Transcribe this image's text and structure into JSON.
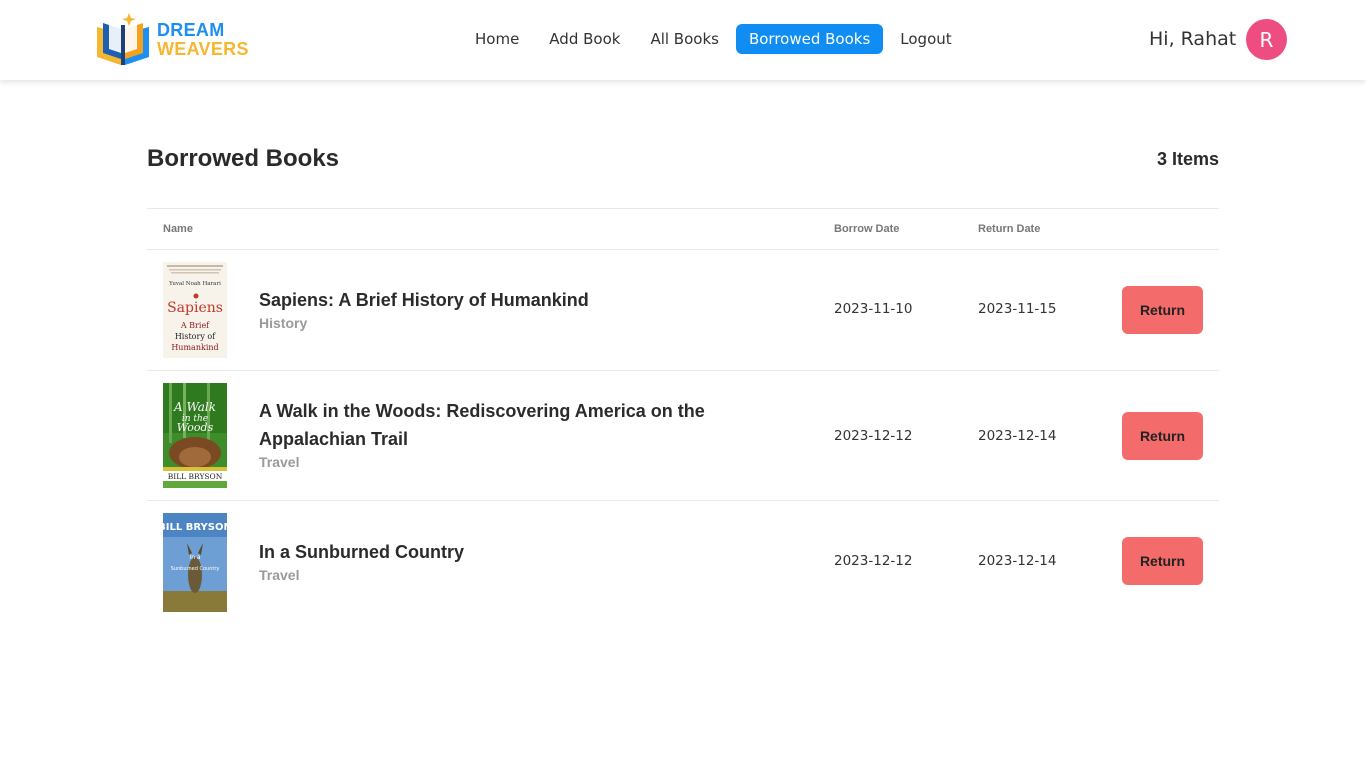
{
  "brand": {
    "line1": "DREAM",
    "line2": "WEAVERS"
  },
  "nav": {
    "items": [
      {
        "label": "Home"
      },
      {
        "label": "Add Book"
      },
      {
        "label": "All Books"
      },
      {
        "label": "Borrowed Books",
        "active": true
      },
      {
        "label": "Logout"
      }
    ]
  },
  "user": {
    "greeting": "Hi, Rahat",
    "avatar_letter": "R"
  },
  "main": {
    "title": "Borrowed Books",
    "count": "3 Items",
    "columns": {
      "name": "Name",
      "borrow": "Borrow Date",
      "return": "Return Date"
    },
    "rows": [
      {
        "title": "Sapiens: A Brief History of Humankind",
        "category": "History",
        "borrow_date": "2023-11-10",
        "return_date": "2023-11-15",
        "action": "Return",
        "cover": {
          "author": "Yuval Noah Harari",
          "word": "Sapiens",
          "sub1": "A Brief",
          "sub2": "History of",
          "sub3": "Humankind"
        }
      },
      {
        "title": "A Walk in the Woods: Rediscovering America on the Appalachian Trail",
        "category": "Travel",
        "borrow_date": "2023-12-12",
        "return_date": "2023-12-14",
        "action": "Return",
        "cover": {
          "t1": "A Walk",
          "t2": "in the",
          "t3": "Woods",
          "author": "BILL BRYSON"
        }
      },
      {
        "title": "In a Sunburned Country",
        "category": "Travel",
        "borrow_date": "2023-12-12",
        "return_date": "2023-12-14",
        "action": "Return",
        "cover": {
          "author": "BILL BRYSON",
          "t1": "In a",
          "t2": "Sunburned Country"
        }
      }
    ]
  },
  "colors": {
    "accent": "#0f8df3",
    "avatar": "#ee4d82",
    "return_button": "#f46b6b",
    "brand_blue": "#1d8ff0",
    "brand_yellow": "#f5b731"
  }
}
